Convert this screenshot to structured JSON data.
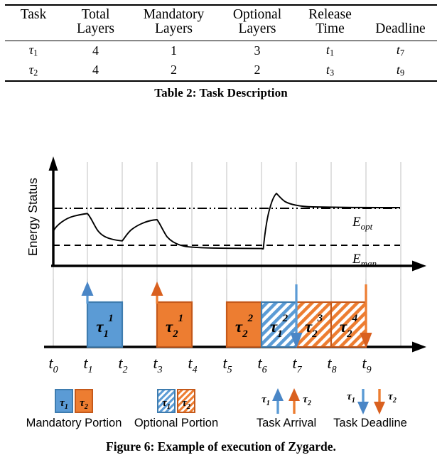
{
  "table": {
    "headers": [
      {
        "line1": "Task",
        "line2": ""
      },
      {
        "line1": "Total",
        "line2": "Layers"
      },
      {
        "line1": "Mandatory",
        "line2": "Layers"
      },
      {
        "line1": "Optional",
        "line2": "Layers"
      },
      {
        "line1": "Release",
        "line2": "Time"
      },
      {
        "line1": "Deadline",
        "line2": ""
      }
    ],
    "rows": [
      {
        "task_base": "τ",
        "task_sub": "1",
        "total_layers": "4",
        "mandatory_layers": "1",
        "optional_layers": "3",
        "release_base": "t",
        "release_sub": "1",
        "deadline_base": "t",
        "deadline_sub": "7"
      },
      {
        "task_base": "τ",
        "task_sub": "2",
        "total_layers": "4",
        "mandatory_layers": "2",
        "optional_layers": "2",
        "release_base": "t",
        "release_sub": "3",
        "deadline_base": "t",
        "deadline_sub": "9"
      }
    ],
    "caption": "Table 2: Task Description"
  },
  "figure": {
    "caption": "Figure 6: Example of execution of Zygarde.",
    "y_axis_label": "Energy Status",
    "threshold_labels": [
      {
        "base": "E",
        "sub": "opt"
      },
      {
        "base": "E",
        "sub": "man"
      }
    ],
    "x_ticks": [
      {
        "base": "t",
        "sub": "0"
      },
      {
        "base": "t",
        "sub": "1"
      },
      {
        "base": "t",
        "sub": "2"
      },
      {
        "base": "t",
        "sub": "3"
      },
      {
        "base": "t",
        "sub": "4"
      },
      {
        "base": "t",
        "sub": "5"
      },
      {
        "base": "t",
        "sub": "6"
      },
      {
        "base": "t",
        "sub": "7"
      },
      {
        "base": "t",
        "sub": "8"
      },
      {
        "base": "t",
        "sub": "9"
      }
    ],
    "colors": {
      "blue": "#5B9BD5",
      "blue_edge": "#3E7CAF",
      "orange": "#ED7D31",
      "orange_edge": "#C5591A",
      "gridline": "#D9D9D9",
      "axis": "#000000"
    },
    "blocks": [
      {
        "label_base": "τ",
        "label_sub": "1",
        "label_sup": "1",
        "start": 1,
        "end": 2,
        "color": "blue",
        "fill": "solid"
      },
      {
        "label_base": "τ",
        "label_sub": "2",
        "label_sup": "1",
        "start": 3,
        "end": 4,
        "color": "orange",
        "fill": "solid"
      },
      {
        "label_base": "τ",
        "label_sub": "2",
        "label_sup": "2",
        "start": 5,
        "end": 6,
        "color": "orange",
        "fill": "solid"
      },
      {
        "label_base": "τ",
        "label_sub": "1",
        "label_sup": "2",
        "start": 6,
        "end": 7,
        "color": "blue",
        "fill": "hatched"
      },
      {
        "label_base": "τ",
        "label_sub": "2",
        "label_sup": "3",
        "start": 7,
        "end": 8,
        "color": "orange",
        "fill": "hatched"
      },
      {
        "label_base": "τ",
        "label_sub": "2",
        "label_sup": "4",
        "start": 8,
        "end": 9,
        "color": "orange",
        "fill": "hatched"
      }
    ],
    "arrivals": [
      {
        "at": 1,
        "color": "blue"
      },
      {
        "at": 3,
        "color": "orange"
      }
    ],
    "deadlines": [
      {
        "at": 7,
        "color": "blue"
      },
      {
        "at": 9,
        "color": "orange"
      }
    ],
    "legend": [
      {
        "id": "mandatory-portion",
        "label": "Mandatory Portion",
        "fill": "solid",
        "swatches": [
          {
            "base": "τ",
            "sub": "1",
            "color": "blue"
          },
          {
            "base": "τ",
            "sub": "2",
            "color": "orange"
          }
        ]
      },
      {
        "id": "optional-portion",
        "label": "Optional Portion",
        "fill": "hatched",
        "swatches": [
          {
            "base": "τ",
            "sub": "1",
            "color": "blue"
          },
          {
            "base": "τ",
            "sub": "2",
            "color": "orange"
          }
        ]
      },
      {
        "id": "task-arrival",
        "label": "Task Arrival",
        "fill": "arrow-up",
        "swatches": [
          {
            "base": "τ",
            "sub": "1",
            "color": "blue"
          },
          {
            "base": "τ",
            "sub": "2",
            "color": "orange"
          }
        ]
      },
      {
        "id": "task-deadline",
        "label": "Task Deadline",
        "fill": "arrow-down",
        "swatches": [
          {
            "base": "τ",
            "sub": "1",
            "color": "blue"
          },
          {
            "base": "τ",
            "sub": "2",
            "color": "orange"
          }
        ]
      }
    ]
  },
  "chart_data": {
    "type": "line",
    "title": "Example of execution of Zygarde",
    "xlabel": "",
    "ylabel": "Energy Status",
    "x_tick_labels": [
      "t0",
      "t1",
      "t2",
      "t3",
      "t4",
      "t5",
      "t6",
      "t7",
      "t8",
      "t9"
    ],
    "grid": true,
    "legend_position": "below",
    "series": [
      {
        "name": "Energy Status",
        "x": [
          0.0,
          0.2,
          0.5,
          0.8,
          1.0,
          1.05,
          1.2,
          1.5,
          1.8,
          2.0,
          2.05,
          2.3,
          2.7,
          3.0,
          3.05,
          3.3,
          3.6,
          4.0,
          4.3,
          4.6,
          5.0,
          5.5,
          5.95,
          6.0,
          6.15,
          6.4,
          6.8,
          7.5,
          9.4
        ],
        "y": [
          0.4,
          0.5,
          0.56,
          0.59,
          0.6,
          0.55,
          0.42,
          0.33,
          0.31,
          0.31,
          0.36,
          0.45,
          0.5,
          0.51,
          0.46,
          0.33,
          0.25,
          0.21,
          0.2,
          0.2,
          0.2,
          0.2,
          0.2,
          0.85,
          0.8,
          0.77,
          0.755,
          0.75,
          0.75
        ]
      }
    ],
    "thresholds": [
      {
        "name": "E_opt",
        "value": 0.68,
        "style": "dash-dot"
      },
      {
        "name": "E_man",
        "value": 0.2,
        "style": "dashed"
      }
    ],
    "schedule_blocks": [
      {
        "task": "tau_1^1",
        "start": 1,
        "end": 2,
        "type": "mandatory",
        "color": "#5B9BD5"
      },
      {
        "task": "tau_2^1",
        "start": 3,
        "end": 4,
        "type": "mandatory",
        "color": "#ED7D31"
      },
      {
        "task": "tau_2^2",
        "start": 5,
        "end": 6,
        "type": "mandatory",
        "color": "#ED7D31"
      },
      {
        "task": "tau_1^2",
        "start": 6,
        "end": 7,
        "type": "optional",
        "color": "#5B9BD5"
      },
      {
        "task": "tau_2^3",
        "start": 7,
        "end": 8,
        "type": "optional",
        "color": "#ED7D31"
      },
      {
        "task": "tau_2^4",
        "start": 8,
        "end": 9,
        "type": "optional",
        "color": "#ED7D31"
      }
    ],
    "events": [
      {
        "kind": "arrival",
        "task": "tau_1",
        "at": 1
      },
      {
        "kind": "arrival",
        "task": "tau_2",
        "at": 3
      },
      {
        "kind": "deadline",
        "task": "tau_1",
        "at": 7
      },
      {
        "kind": "deadline",
        "task": "tau_2",
        "at": 9
      }
    ]
  }
}
